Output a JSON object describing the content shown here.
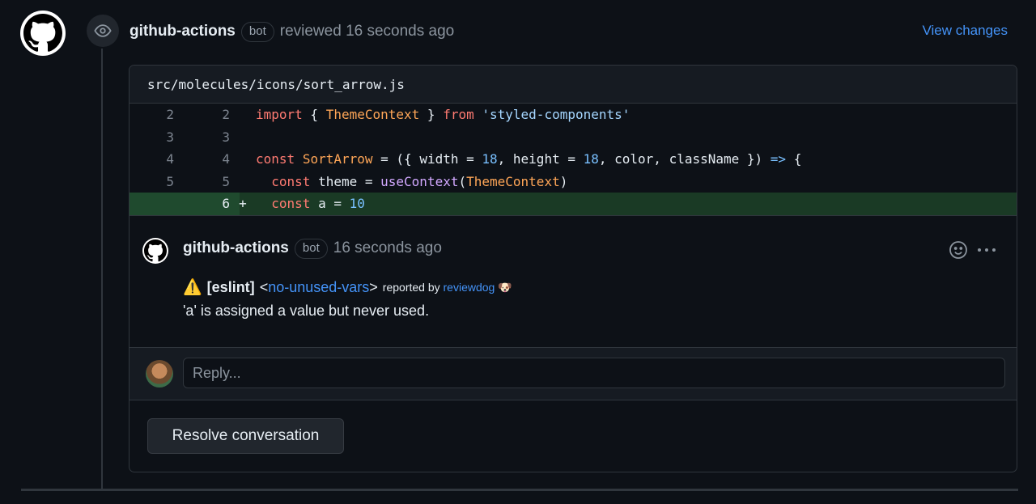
{
  "review": {
    "author": "github-actions",
    "badge": "bot",
    "action_text": "reviewed 16 seconds ago",
    "view_changes_label": "View changes"
  },
  "file": {
    "path": "src/molecules/icons/sort_arrow.js"
  },
  "diff_lines": [
    {
      "old": "2",
      "new": "2",
      "sign": "",
      "type": "context"
    },
    {
      "old": "3",
      "new": "3",
      "sign": "",
      "type": "context"
    },
    {
      "old": "4",
      "new": "4",
      "sign": "",
      "type": "context"
    },
    {
      "old": "5",
      "new": "5",
      "sign": "",
      "type": "context"
    },
    {
      "old": "",
      "new": "6",
      "sign": "+",
      "type": "added"
    }
  ],
  "code_tokens": {
    "l1": [
      "import",
      " { ",
      "ThemeContext",
      " } ",
      "from",
      " ",
      "'styled-components'"
    ],
    "l3": [
      "const",
      " ",
      "SortArrow",
      " = ({ width = ",
      "18",
      ", height = ",
      "18",
      ", color, className }) ",
      "=>",
      " {"
    ],
    "l4": [
      "  ",
      "const",
      " theme = ",
      "useContext",
      "(",
      "ThemeContext",
      ")"
    ],
    "l5": [
      "  ",
      "const",
      " a = ",
      "10"
    ]
  },
  "comment": {
    "author": "github-actions",
    "badge": "bot",
    "time": "16 seconds ago",
    "warning_icon": "⚠️",
    "tag": "[eslint]",
    "rule_open": "<",
    "rule": "no-unused-vars",
    "rule_close": ">",
    "reported_by_text": "reported by",
    "reporter": "reviewdog",
    "reporter_icon": "🐶",
    "message": "'a' is assigned a value but never used.",
    "reaction_icon": "smiley-icon",
    "menu_icon": "kebab-horizontal-icon"
  },
  "reply": {
    "placeholder": "Reply..."
  },
  "resolve_label": "Resolve conversation",
  "colors": {
    "background": "#0d1117",
    "link": "#4493f8",
    "added_row": "#1a3a25",
    "border": "#30363d"
  }
}
